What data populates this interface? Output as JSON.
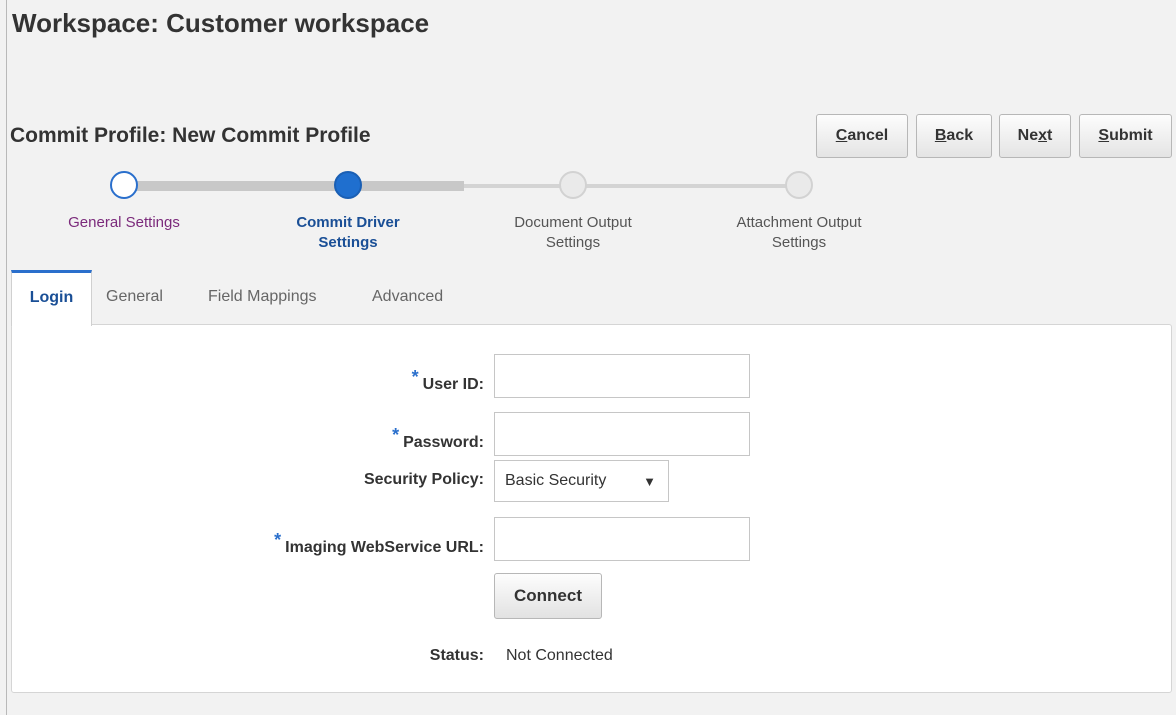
{
  "workspace_title": "Workspace: Customer workspace",
  "profile_title": "Commit Profile: New Commit Profile",
  "buttons": {
    "cancel": {
      "label": "ancel",
      "mnemonic": "C"
    },
    "back": {
      "label": "ack",
      "mnemonic": "B"
    },
    "next": {
      "prefix": "Ne",
      "mnemonic": "x",
      "suffix": "t"
    },
    "submit": {
      "label": "ubmit",
      "mnemonic": "S"
    }
  },
  "train": {
    "steps": [
      {
        "label_line1": "General Settings",
        "label_line2": "",
        "state": "visited"
      },
      {
        "label_line1": "Commit Driver",
        "label_line2": "Settings",
        "state": "current"
      },
      {
        "label_line1": "Document Output",
        "label_line2": "Settings",
        "state": "unvisited"
      },
      {
        "label_line1": "Attachment Output",
        "label_line2": "Settings",
        "state": "unvisited"
      }
    ]
  },
  "tabs": [
    {
      "label": "Login",
      "active": true
    },
    {
      "label": "General",
      "active": false
    },
    {
      "label": "Field Mappings",
      "active": false
    },
    {
      "label": "Advanced",
      "active": false
    }
  ],
  "form": {
    "required_marker": "*",
    "user_id_label": "User ID:",
    "user_id_value": "",
    "password_label": "Password:",
    "password_value": "",
    "security_policy_label": "Security Policy:",
    "security_policy_value": "Basic Security",
    "url_label": "Imaging WebService URL:",
    "url_value": "",
    "connect_label": "Connect",
    "status_label": "Status:",
    "status_value": "Not Connected"
  },
  "colors": {
    "accent": "#2a6fcc",
    "visited_label": "#7b2a7b",
    "current_label": "#1a4f96"
  }
}
